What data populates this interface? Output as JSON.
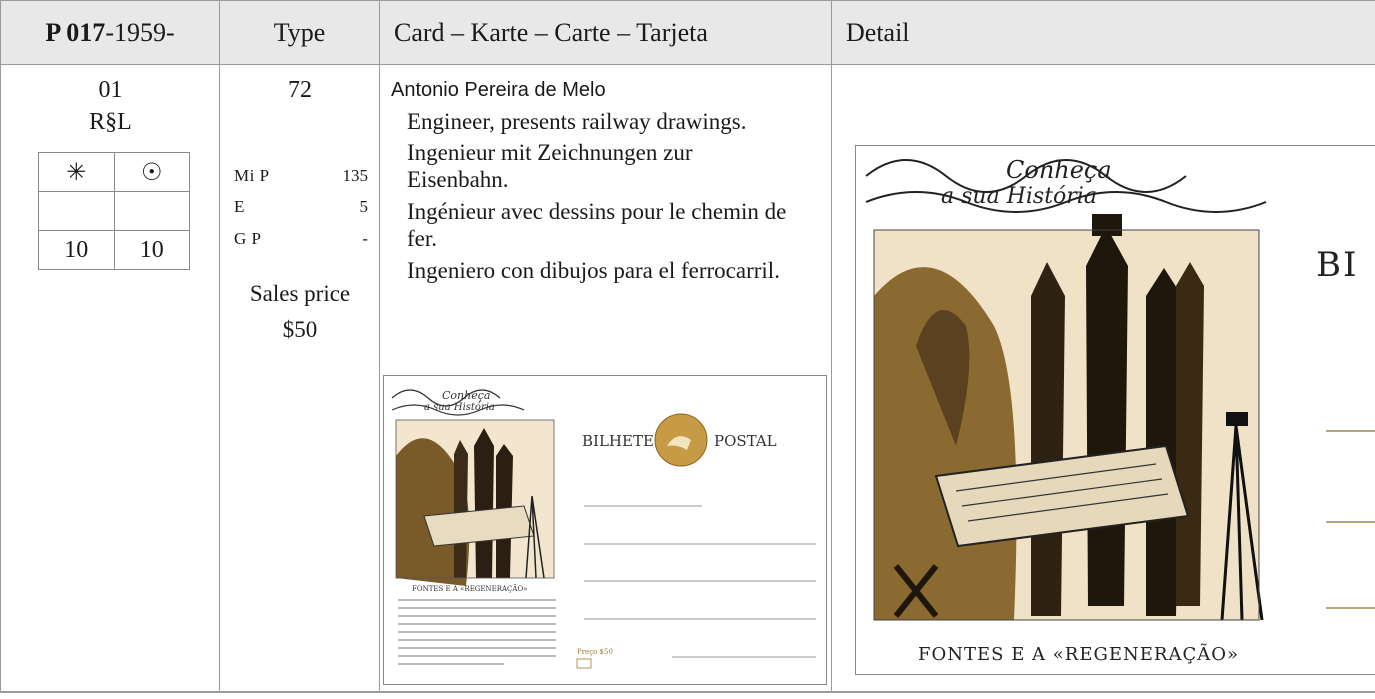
{
  "header": {
    "catalog_bold": "P 017",
    "catalog_rest": "-1959-",
    "type": "Type",
    "card": "Card – Karte – Carte – Tarjeta",
    "detail": "Detail"
  },
  "row": {
    "number": "01",
    "variant": "R§L",
    "symbols": {
      "mint": "✳",
      "used": "☉"
    },
    "prices": {
      "mint": "10",
      "used": "10"
    },
    "type_no": "72",
    "catalogs": [
      {
        "label": "Mi  P",
        "value": "135"
      },
      {
        "label": "E",
        "value": "5"
      },
      {
        "label": "G  P",
        "value": "-"
      }
    ],
    "sales_label": "Sales price",
    "sales_value": "$50",
    "name": "Antonio Pereira de Melo",
    "desc_en": "Engineer, presents railway drawings.",
    "desc_de": "Ingenieur mit Zeichnungen zur Eisenbahn.",
    "desc_fr": "Ingénieur avec dessins pour le chemin de fer.",
    "desc_es": "Ingeniero con dibujos para el ferrocarril."
  },
  "card_image": {
    "banner1": "Conheça",
    "banner2": "a sua História",
    "postal_left": "BILHETE",
    "postal_right": "POSTAL",
    "caption": "FONTES E A «REGENERAÇÃO»",
    "price": "Preço $50"
  },
  "detail_image": {
    "banner1": "Conheça",
    "banner2": "a sua História",
    "postal": "BI",
    "caption": "FONTES E A «REGENERAÇÃO»"
  }
}
